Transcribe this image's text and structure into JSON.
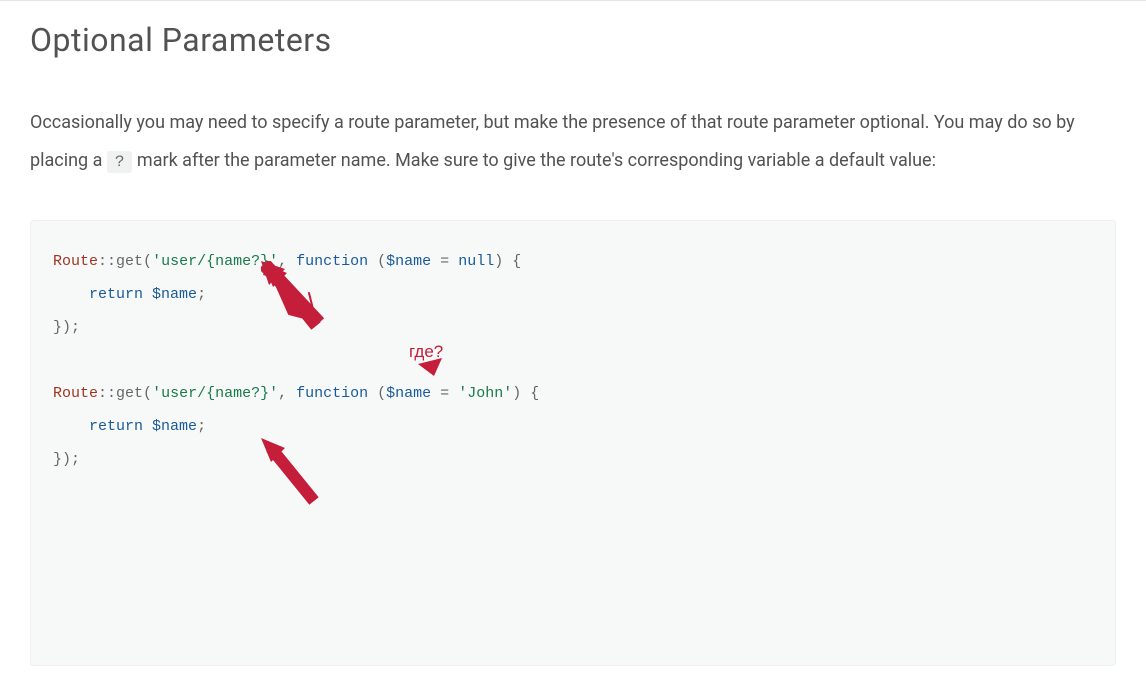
{
  "heading": "Optional Parameters",
  "paragraph": {
    "part1": "Occasionally you may need to specify a route parameter, but make the presence of that route parameter optional. You may do so by placing a ",
    "inline_code": "?",
    "part2": " mark after the parameter name. Make sure to give the route's corresponding variable a default value:"
  },
  "code": {
    "line1": {
      "route": "Route",
      "scope": "::",
      "get": "get",
      "paren_open": "(",
      "string": "'user/{name?}'",
      "comma": ", ",
      "function": "function",
      "space": " ",
      "paren2_open": "(",
      "var": "$name",
      "equals": " = ",
      "null": "null",
      "paren2_close": ")",
      "brace": " {"
    },
    "line2": {
      "indent": "    ",
      "return": "return",
      "space": " ",
      "var": "$name",
      "semi": ";"
    },
    "line3": {
      "close": "});"
    },
    "line4": " ",
    "line5": {
      "route": "Route",
      "scope": "::",
      "get": "get",
      "paren_open": "(",
      "string": "'user/{name?}'",
      "comma": ", ",
      "function": "function",
      "space": " ",
      "paren2_open": "(",
      "var": "$name",
      "equals": " = ",
      "default": "'John'",
      "paren2_close": ")",
      "brace": " {"
    },
    "line6": {
      "indent": "    ",
      "return": "return",
      "space": " ",
      "var": "$name",
      "semi": ";"
    },
    "line7": {
      "close": "});"
    }
  },
  "annotation": {
    "text": "где?"
  }
}
